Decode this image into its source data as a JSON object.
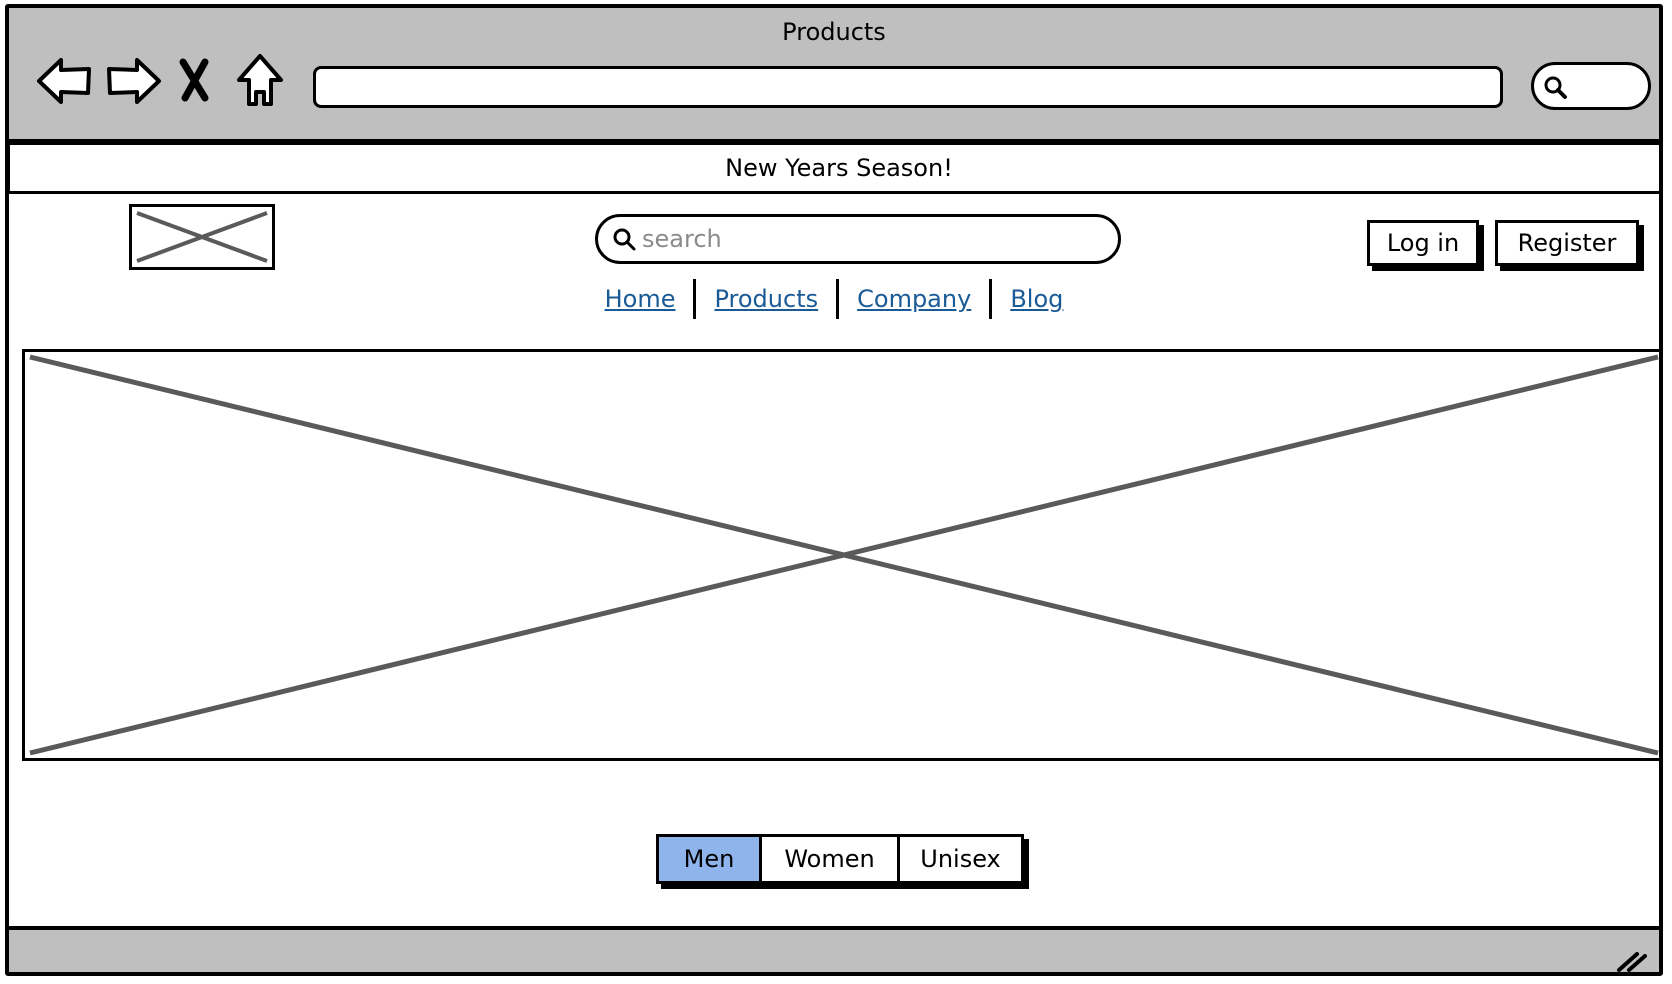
{
  "window": {
    "title": "Products"
  },
  "toolbar": {
    "back_icon": "back-arrow-icon",
    "forward_icon": "forward-arrow-icon",
    "stop_icon": "close-icon",
    "home_icon": "home-icon",
    "address_value": "",
    "search_icon": "search-icon"
  },
  "banner": {
    "text": "New Years Season!"
  },
  "header": {
    "logo_icon": "image-placeholder-icon",
    "search_placeholder": "search",
    "search_value": "",
    "login_label": "Log in",
    "register_label": "Register"
  },
  "nav": {
    "items": [
      {
        "label": "Home"
      },
      {
        "label": "Products"
      },
      {
        "label": "Company"
      },
      {
        "label": "Blog"
      }
    ]
  },
  "hero": {
    "icon": "image-placeholder-icon"
  },
  "category_tabs": {
    "selected": "Men",
    "options": [
      {
        "label": "Men"
      },
      {
        "label": "Women"
      },
      {
        "label": "Unisex"
      }
    ]
  },
  "colors": {
    "chrome": "#bfbfbf",
    "link": "#1a5a96",
    "selected_tab": "#8fb4ec",
    "placeholder_x": "#5a5a5a"
  }
}
